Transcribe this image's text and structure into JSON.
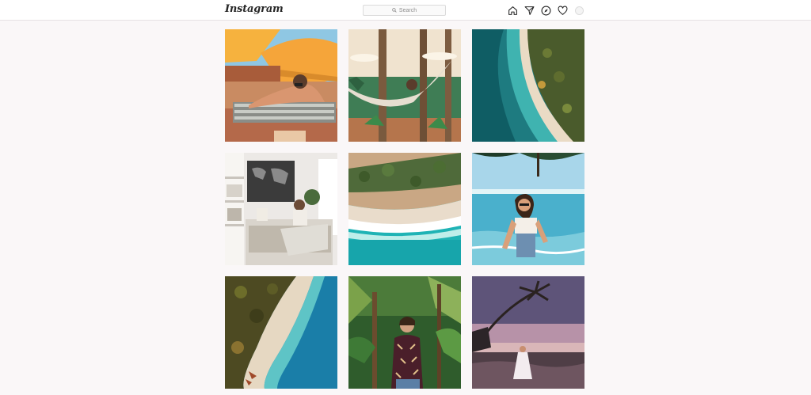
{
  "header": {
    "logo_text": "Instagram",
    "search": {
      "placeholder": "Search",
      "icon": "search-icon"
    },
    "nav_icons": [
      "home-icon",
      "direct-icon",
      "explore-icon",
      "activity-icon",
      "avatar"
    ]
  },
  "grid": {
    "rows": 3,
    "columns": 3,
    "posts": [
      {
        "scene": "woman lounging on sunbed under orange umbrellas"
      },
      {
        "scene": "woman in hammock between palm trees"
      },
      {
        "scene": "aerial view of tropical beach and turquoise sea"
      },
      {
        "scene": "woman reading on bed in bright bedroom with world map"
      },
      {
        "scene": "aerial view of palm-lined beach with waves"
      },
      {
        "scene": "smiling woman wading in sea under palms"
      },
      {
        "scene": "aerial view of curved beach and jungle"
      },
      {
        "scene": "woman in patterned dress in jungle"
      },
      {
        "scene": "woman in white dress on beach at purple sunset"
      }
    ]
  },
  "colors": {
    "page_bg": "#faf7f8",
    "header_bg": "#ffffff",
    "icon": "#262626"
  }
}
